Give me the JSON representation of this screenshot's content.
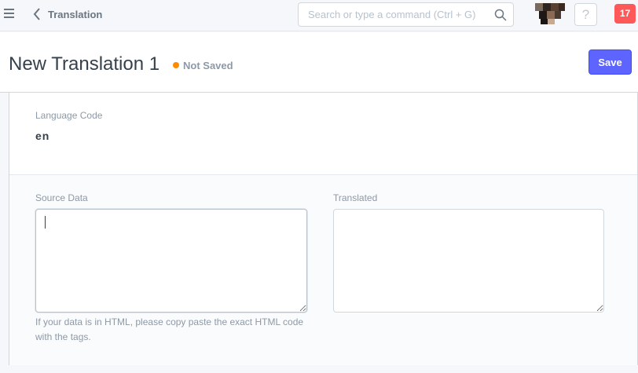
{
  "navbar": {
    "breadcrumb": "Translation",
    "search_placeholder": "Search or type a command (Ctrl + G)",
    "help_label": "?",
    "notification_count": "17"
  },
  "page": {
    "title": "New Translation 1",
    "status": "Not Saved",
    "status_color": "#ff8c00",
    "save_label": "Save"
  },
  "form": {
    "language_code_label": "Language Code",
    "language_code_value": "en",
    "source_label": "Source Data",
    "source_value": "",
    "source_help": "If your data is in HTML, please copy paste the exact HTML code with the tags.",
    "translated_label": "Translated",
    "translated_value": ""
  },
  "colors": {
    "primary": "#5e64ff",
    "notification": "#ff5858"
  }
}
